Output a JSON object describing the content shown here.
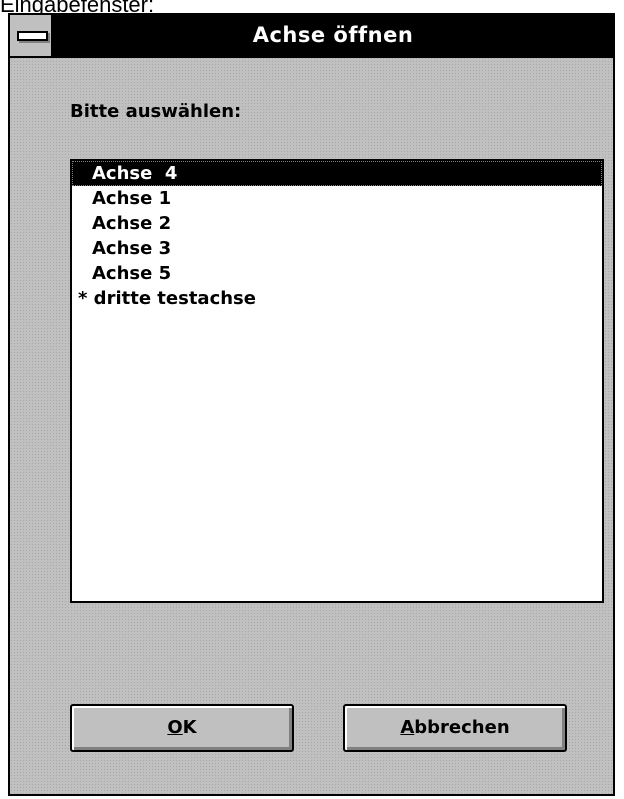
{
  "background_caption": "Eingabefenster:",
  "window": {
    "title": "Achse öffnen",
    "system_menu_icon": "system-menu-icon"
  },
  "prompt": {
    "label": "Bitte auswählen:"
  },
  "axis_list": {
    "selected_index": 0,
    "items": [
      {
        "label": "Achse  4"
      },
      {
        "label": "Achse 1"
      },
      {
        "label": "Achse 2"
      },
      {
        "label": "Achse 3"
      },
      {
        "label": "Achse 5"
      },
      {
        "label": "* dritte testachse"
      }
    ]
  },
  "buttons": {
    "ok": {
      "mnemonic": "O",
      "rest": "K"
    },
    "cancel": {
      "mnemonic": "A",
      "rest": "bbrechen"
    }
  },
  "colors": {
    "titlebar": "#000000",
    "title_text": "#ffffff",
    "dialog_face": "#c0c0c0",
    "selection": "#000000"
  }
}
